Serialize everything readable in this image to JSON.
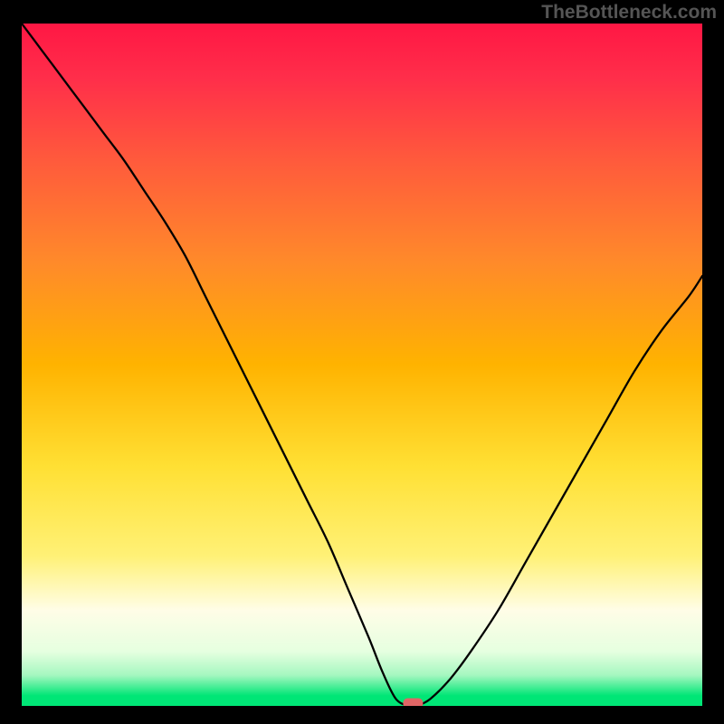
{
  "watermark": "TheBottleneck.com",
  "chart_data": {
    "type": "line",
    "title": "",
    "xlabel": "",
    "ylabel": "",
    "xlim": [
      0,
      100
    ],
    "ylim": [
      0,
      100
    ],
    "series": [
      {
        "name": "bottleneck-curve",
        "x": [
          0,
          3,
          6,
          9,
          12,
          15,
          18,
          21,
          24,
          27,
          30,
          33,
          36,
          39,
          42,
          45,
          48,
          51,
          53,
          55,
          57,
          58,
          60,
          63,
          66,
          70,
          74,
          78,
          82,
          86,
          90,
          94,
          98,
          100
        ],
        "y": [
          100,
          96,
          92,
          88,
          84,
          80,
          75.5,
          71,
          66,
          60,
          54,
          48,
          42,
          36,
          30,
          24,
          17,
          10,
          5,
          1,
          0,
          0,
          1,
          4,
          8,
          14,
          21,
          28,
          35,
          42,
          49,
          55,
          60,
          63
        ]
      }
    ],
    "marker": {
      "x": 57.5,
      "y": 0,
      "color": "#e06666"
    },
    "gradient_stops": [
      {
        "offset": 0.0,
        "color": "#ff1744"
      },
      {
        "offset": 0.08,
        "color": "#ff2e4a"
      },
      {
        "offset": 0.2,
        "color": "#ff5a3c"
      },
      {
        "offset": 0.35,
        "color": "#ff8a2a"
      },
      {
        "offset": 0.5,
        "color": "#ffb300"
      },
      {
        "offset": 0.65,
        "color": "#ffe034"
      },
      {
        "offset": 0.78,
        "color": "#fff176"
      },
      {
        "offset": 0.86,
        "color": "#fffde7"
      },
      {
        "offset": 0.92,
        "color": "#e6ffe0"
      },
      {
        "offset": 0.955,
        "color": "#a5f7c0"
      },
      {
        "offset": 0.985,
        "color": "#00e676"
      },
      {
        "offset": 1.0,
        "color": "#00e676"
      }
    ]
  }
}
